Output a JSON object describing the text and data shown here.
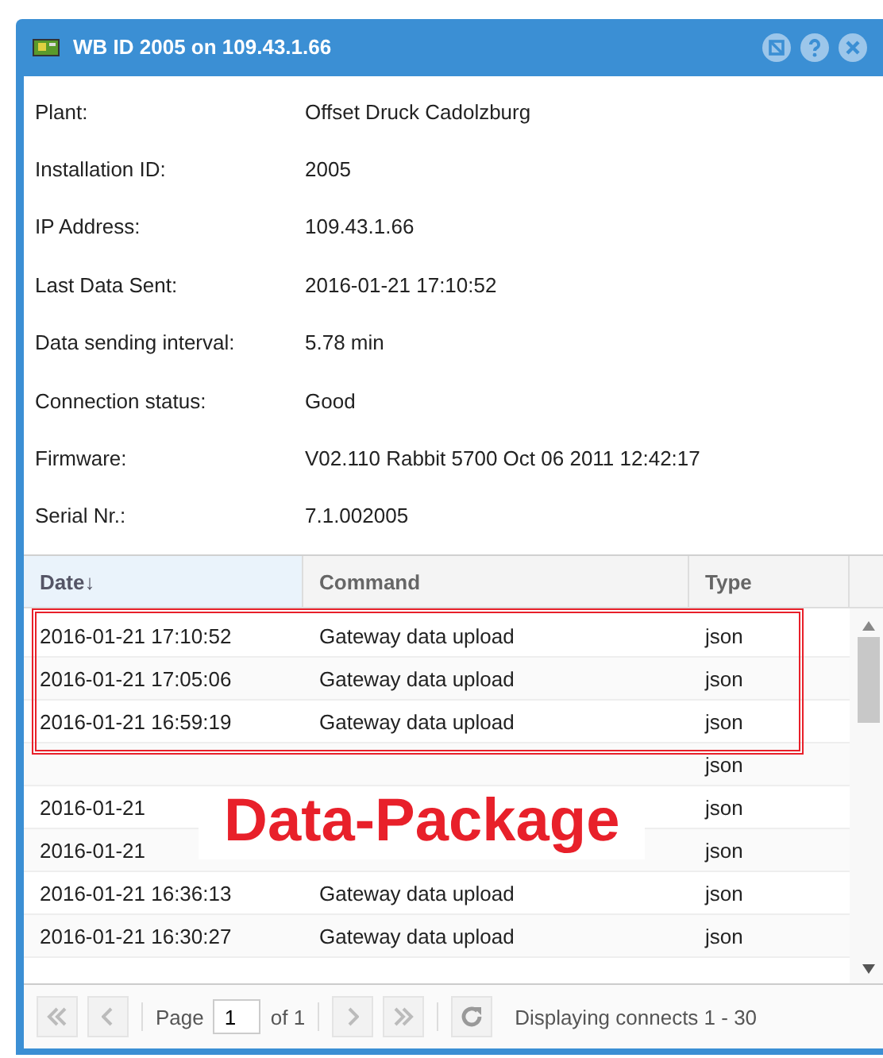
{
  "window": {
    "title": "WB ID 2005 on 109.43.1.66"
  },
  "details": [
    {
      "label": "Plant:",
      "value": "Offset Druck Cadolzburg"
    },
    {
      "label": "Installation ID:",
      "value": "2005"
    },
    {
      "label": "IP Address:",
      "value": "109.43.1.66"
    },
    {
      "label": "Last Data Sent:",
      "value": "2016-01-21 17:10:52"
    },
    {
      "label": "Data sending interval:",
      "value": "5.78 min"
    },
    {
      "label": "Connection status:",
      "value": "Good"
    },
    {
      "label": "Firmware:",
      "value": "V02.110 Rabbit 5700 Oct 06 2011 12:42:17"
    },
    {
      "label": "Serial Nr.:",
      "value": "7.1.002005"
    }
  ],
  "table": {
    "columns": [
      {
        "label": "Date",
        "sort_icon": "↓",
        "selected": true
      },
      {
        "label": "Command",
        "selected": false
      },
      {
        "label": "Type",
        "selected": false
      }
    ],
    "rows": [
      {
        "date": "2016-01-21 17:10:52",
        "command": "Gateway data upload",
        "type": "json"
      },
      {
        "date": "2016-01-21 17:05:06",
        "command": "Gateway data upload",
        "type": "json"
      },
      {
        "date": "2016-01-21 16:59:19",
        "command": "Gateway data upload",
        "type": "json"
      },
      {
        "date": "",
        "command": "",
        "type": "json"
      },
      {
        "date": "2016-01-21",
        "command": "",
        "type": "json"
      },
      {
        "date": "2016-01-21",
        "command": "",
        "type": "json"
      },
      {
        "date": "2016-01-21 16:36:13",
        "command": "Gateway data upload",
        "type": "json"
      },
      {
        "date": "2016-01-21 16:30:27",
        "command": "Gateway data upload",
        "type": "json"
      }
    ]
  },
  "pager": {
    "page_label": "Page",
    "page": "1",
    "of_label": "of 1",
    "status": "Displaying connects 1 - 30"
  },
  "annotation": {
    "label": "Data-Package"
  }
}
